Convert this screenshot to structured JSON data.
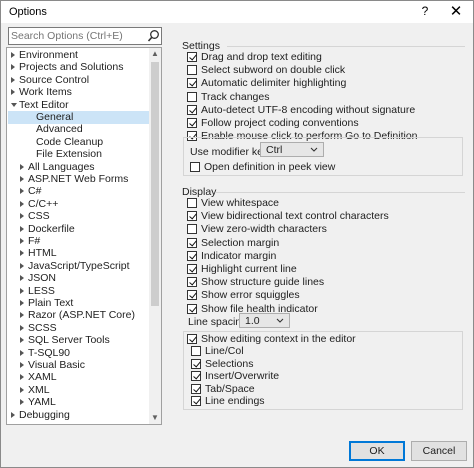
{
  "window": {
    "title": "Options",
    "help_glyph": "?",
    "close_glyph": "✕"
  },
  "search": {
    "placeholder": "Search Options (Ctrl+E)"
  },
  "tree": [
    {
      "label": "Environment",
      "expander": "collapsed",
      "level": 0
    },
    {
      "label": "Projects and Solutions",
      "expander": "collapsed",
      "level": 0
    },
    {
      "label": "Source Control",
      "expander": "collapsed",
      "level": 0
    },
    {
      "label": "Work Items",
      "expander": "collapsed",
      "level": 0
    },
    {
      "label": "Text Editor",
      "expander": "expanded",
      "level": 0
    },
    {
      "label": "General",
      "expander": "none",
      "level": 1,
      "selected": true
    },
    {
      "label": "Advanced",
      "expander": "none",
      "level": 1
    },
    {
      "label": "Code Cleanup",
      "expander": "none",
      "level": 1
    },
    {
      "label": "File Extension",
      "expander": "none",
      "level": 1
    },
    {
      "label": "All Languages",
      "expander": "collapsed",
      "level": 1
    },
    {
      "label": "ASP.NET Web Forms",
      "expander": "collapsed",
      "level": 1
    },
    {
      "label": "C#",
      "expander": "collapsed",
      "level": 1
    },
    {
      "label": "C/C++",
      "expander": "collapsed",
      "level": 1
    },
    {
      "label": "CSS",
      "expander": "collapsed",
      "level": 1
    },
    {
      "label": "Dockerfile",
      "expander": "collapsed",
      "level": 1
    },
    {
      "label": "F#",
      "expander": "collapsed",
      "level": 1
    },
    {
      "label": "HTML",
      "expander": "collapsed",
      "level": 1
    },
    {
      "label": "JavaScript/TypeScript",
      "expander": "collapsed",
      "level": 1
    },
    {
      "label": "JSON",
      "expander": "collapsed",
      "level": 1
    },
    {
      "label": "LESS",
      "expander": "collapsed",
      "level": 1
    },
    {
      "label": "Plain Text",
      "expander": "collapsed",
      "level": 1
    },
    {
      "label": "Razor (ASP.NET Core)",
      "expander": "collapsed",
      "level": 1
    },
    {
      "label": "SCSS",
      "expander": "collapsed",
      "level": 1
    },
    {
      "label": "SQL Server Tools",
      "expander": "collapsed",
      "level": 1
    },
    {
      "label": "T-SQL90",
      "expander": "collapsed",
      "level": 1
    },
    {
      "label": "Visual Basic",
      "expander": "collapsed",
      "level": 1
    },
    {
      "label": "XAML",
      "expander": "collapsed",
      "level": 1
    },
    {
      "label": "XML",
      "expander": "collapsed",
      "level": 1
    },
    {
      "label": "YAML",
      "expander": "collapsed",
      "level": 1
    },
    {
      "label": "Debugging",
      "expander": "collapsed",
      "level": 0
    }
  ],
  "settings": {
    "heading": "Settings",
    "items": [
      {
        "label": "Drag and drop text editing",
        "checked": true
      },
      {
        "label": "Select subword on double click",
        "checked": false
      },
      {
        "label": "Automatic delimiter highlighting",
        "checked": true
      },
      {
        "label": "Track changes",
        "checked": false
      },
      {
        "label": "Auto-detect UTF-8 encoding without signature",
        "checked": true
      },
      {
        "label": "Follow project coding conventions",
        "checked": true
      },
      {
        "label": "Enable mouse click to perform Go to Definition",
        "checked": true
      }
    ],
    "modifier_key_label": "Use modifier key:",
    "modifier_key_value": "Ctrl",
    "peek_label": "Open definition in peek view",
    "peek_checked": false
  },
  "display": {
    "heading": "Display",
    "items": [
      {
        "label": "View whitespace",
        "checked": false
      },
      {
        "label": "View bidirectional text control characters",
        "checked": true
      },
      {
        "label": "View zero-width characters",
        "checked": false
      },
      {
        "label": "Selection margin",
        "checked": true
      },
      {
        "label": "Indicator margin",
        "checked": true
      },
      {
        "label": "Highlight current line",
        "checked": true
      },
      {
        "label": "Show structure guide lines",
        "checked": true
      },
      {
        "label": "Show error squiggles",
        "checked": true
      },
      {
        "label": "Show file health indicator",
        "checked": true
      }
    ],
    "line_spacing_label": "Line spacing",
    "line_spacing_value": "1.0",
    "context": {
      "label": "Show editing context in the editor",
      "checked": true
    },
    "context_items": [
      {
        "label": "Line/Col",
        "checked": false
      },
      {
        "label": "Selections",
        "checked": true
      },
      {
        "label": "Insert/Overwrite",
        "checked": true
      },
      {
        "label": "Tab/Space",
        "checked": true
      },
      {
        "label": "Line endings",
        "checked": true
      }
    ]
  },
  "buttons": {
    "ok": "OK",
    "cancel": "Cancel"
  }
}
